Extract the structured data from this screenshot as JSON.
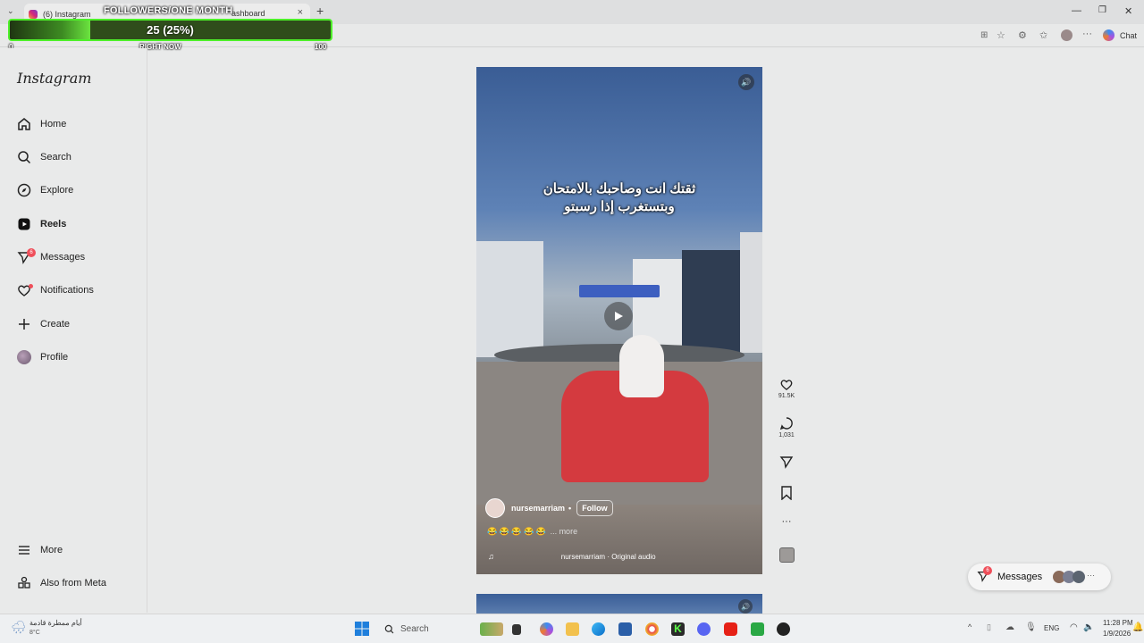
{
  "browser": {
    "tab_title": "(6) Instagram",
    "tab2_partial": "ashboard",
    "chat_label": "Chat"
  },
  "overlay": {
    "title": "FOLLOWERS/ONE MONTH",
    "value_text": "25 (25%)",
    "progress_fraction": 0.25,
    "min_label": "0",
    "mid_label": "RIGHT NOW",
    "max_label": "100"
  },
  "sidebar": {
    "logo": "Instagram",
    "items": [
      {
        "label": "Home",
        "icon": "home-icon"
      },
      {
        "label": "Search",
        "icon": "search-icon"
      },
      {
        "label": "Explore",
        "icon": "compass-icon"
      },
      {
        "label": "Reels",
        "icon": "reels-icon"
      },
      {
        "label": "Messages",
        "icon": "messenger-icon",
        "badge": "6"
      },
      {
        "label": "Notifications",
        "icon": "heart-icon"
      },
      {
        "label": "Create",
        "icon": "plus-icon"
      },
      {
        "label": "Profile",
        "icon": "avatar"
      }
    ],
    "more": "More",
    "also_from_meta": "Also from Meta"
  },
  "reel": {
    "caption_line1": "ثقتك انت وصاحبك بالامتحان",
    "caption_line2": "وبتستغرب إذا رسبتو",
    "username": "nursemarriam",
    "separator": "•",
    "follow": "Follow",
    "emojis": "😂 😂 😂 😂 😂",
    "more": "... more",
    "audio": "nursemarriam · Original audio",
    "likes": "91.5K",
    "comments": "1,031"
  },
  "messages_pill": {
    "label": "Messages",
    "badge": "6"
  },
  "taskbar": {
    "weather_text": "أيام ممطرة قادمة",
    "temp": "8°C",
    "search": "Search",
    "lang": "ENG",
    "time": "11:28 PM",
    "date": "1/9/2026"
  },
  "colors": {
    "accent_green": "#4ef02a",
    "badge_red": "#ef4f5a"
  }
}
